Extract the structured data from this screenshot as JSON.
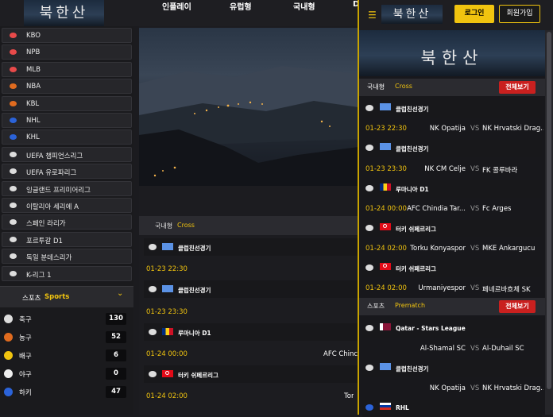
{
  "header": {
    "logo_text": "북한산",
    "nav": [
      "인플레이",
      "유럽형",
      "국내형",
      "D"
    ]
  },
  "sidebar": {
    "leagues": [
      {
        "label": "KBO",
        "icon": "baseball-icon",
        "color": "#e84a4a"
      },
      {
        "label": "NPB",
        "icon": "baseball-icon",
        "color": "#e84a4a"
      },
      {
        "label": "MLB",
        "icon": "baseball-icon",
        "color": "#e84a4a"
      },
      {
        "label": "NBA",
        "icon": "basketball-icon",
        "color": "#e06b1f"
      },
      {
        "label": "KBL",
        "icon": "basketball-icon",
        "color": "#e06b1f"
      },
      {
        "label": "NHL",
        "icon": "hockey-icon",
        "color": "#2b63d9"
      },
      {
        "label": "KHL",
        "icon": "hockey-icon",
        "color": "#2b63d9"
      },
      {
        "label": "UEFA 챔피언스리그",
        "icon": "soccer-icon",
        "color": "#dddddd"
      },
      {
        "label": "UEFA 유로파리그",
        "icon": "soccer-icon",
        "color": "#dddddd"
      },
      {
        "label": "잉글랜드 프리미어리그",
        "icon": "soccer-icon",
        "color": "#dddddd"
      },
      {
        "label": "이탈리아 세리에 A",
        "icon": "soccer-icon",
        "color": "#dddddd"
      },
      {
        "label": "스페인 라리가",
        "icon": "soccer-icon",
        "color": "#dddddd"
      },
      {
        "label": "포르투갈 D1",
        "icon": "soccer-icon",
        "color": "#dddddd"
      },
      {
        "label": "독일 분데스리가",
        "icon": "soccer-icon",
        "color": "#dddddd"
      },
      {
        "label": "K-리그 1",
        "icon": "soccer-icon",
        "color": "#dddddd"
      }
    ],
    "sports_head": {
      "a": "스포츠",
      "b": "Sports"
    },
    "sports": [
      {
        "label": "축구",
        "count": "130",
        "icon": "soccer-icon",
        "color": "#dddddd"
      },
      {
        "label": "농구",
        "count": "52",
        "icon": "basketball-icon",
        "color": "#e06b1f"
      },
      {
        "label": "배구",
        "count": "6",
        "icon": "volleyball-icon",
        "color": "#f1c40f"
      },
      {
        "label": "야구",
        "count": "0",
        "icon": "baseball-icon",
        "color": "#eeeeee"
      },
      {
        "label": "하키",
        "count": "47",
        "icon": "hockey-icon",
        "color": "#2b63d9"
      }
    ]
  },
  "main": {
    "section": {
      "a": "국내형",
      "b": "Cross"
    },
    "items": [
      {
        "kind": "league",
        "name": "클럽친선경기",
        "flag": "un"
      },
      {
        "kind": "time",
        "text": "01-23 22:30",
        "home": ""
      },
      {
        "kind": "league",
        "name": "클럽친선경기",
        "flag": "un"
      },
      {
        "kind": "time",
        "text": "01-23 23:30",
        "home": ""
      },
      {
        "kind": "league",
        "name": "루마니아 D1",
        "flag": "ro"
      },
      {
        "kind": "time",
        "text": "01-24 00:00",
        "home": "AFC Chinc"
      },
      {
        "kind": "league",
        "name": "터키 쉬페르리그",
        "flag": "tr"
      },
      {
        "kind": "time",
        "text": "01-24 02:00",
        "home": "Tor"
      }
    ]
  },
  "overlay": {
    "login": "로그인",
    "signup": "회원가입",
    "section1": {
      "a": "국내형",
      "b": "Cross",
      "btn": "전체보기"
    },
    "items1": [
      {
        "kind": "league",
        "name": "클럽친선경기",
        "flag": "un"
      },
      {
        "kind": "match",
        "time": "01-23 22:30",
        "home": "NK Opatija",
        "vs": "VS",
        "away": "NK Hrvatski Drag..."
      },
      {
        "kind": "league",
        "name": "클럽친선경기",
        "flag": "un"
      },
      {
        "kind": "match",
        "time": "01-23 23:30",
        "home": "NK CM Celje",
        "vs": "VS",
        "away": "FK 콜루바라"
      },
      {
        "kind": "league",
        "name": "루마니아 D1",
        "flag": "ro"
      },
      {
        "kind": "match",
        "time": "01-24 00:00",
        "home": "AFC Chindia Tar...",
        "vs": "VS",
        "away": "Fc Arges"
      },
      {
        "kind": "league",
        "name": "터키 쉬페르리그",
        "flag": "tr"
      },
      {
        "kind": "match",
        "time": "01-24 02:00",
        "home": "Torku Konyaspor",
        "vs": "VS",
        "away": "MKE Ankargucu"
      },
      {
        "kind": "league",
        "name": "터키 쉬페르리그",
        "flag": "tr"
      },
      {
        "kind": "match",
        "time": "01-24 02:00",
        "home": "Urmaniyespor",
        "vs": "VS",
        "away": "페네르바흐체 SK"
      }
    ],
    "section2": {
      "a": "스포츠",
      "b": "Prematch",
      "btn": "전체보기"
    },
    "items2": [
      {
        "kind": "league",
        "name": "Qatar - Stars League",
        "flag": "qa"
      },
      {
        "kind": "match",
        "time": "",
        "home": "Al-Shamal SC",
        "vs": "VS",
        "away": "Al-Duhail SC"
      },
      {
        "kind": "league",
        "name": "클럽친선경기",
        "flag": "un"
      },
      {
        "kind": "match",
        "time": "",
        "home": "NK Opatija",
        "vs": "VS",
        "away": "NK Hrvatski Drag..."
      },
      {
        "kind": "league",
        "name": "RHL",
        "flag": "ru",
        "sport": "hockey"
      }
    ]
  }
}
